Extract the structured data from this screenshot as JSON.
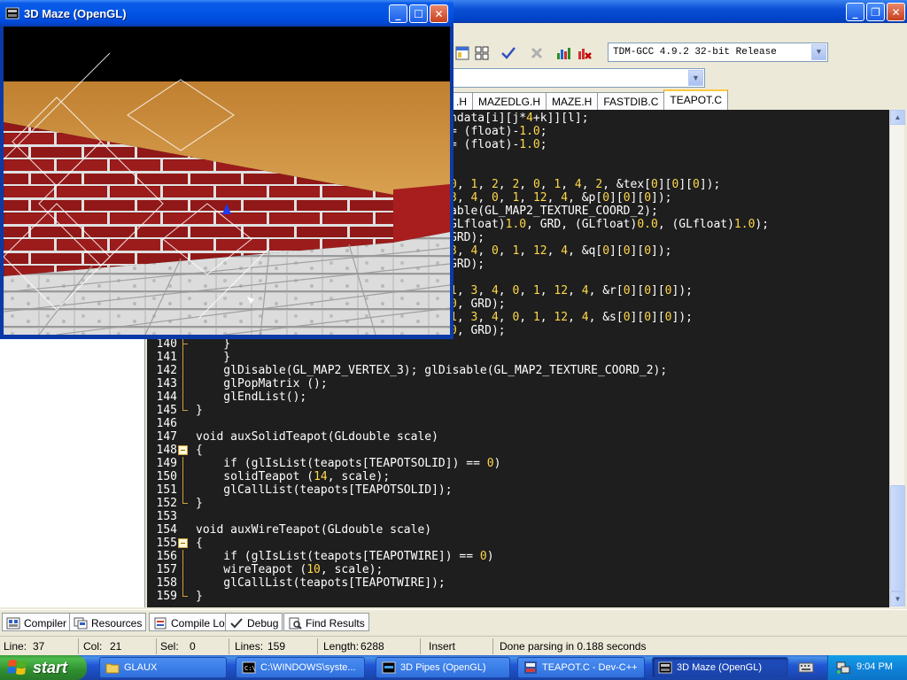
{
  "ide": {
    "compiler": "TDM-GCC 4.9.2 32-bit Release",
    "file_tabs": [
      {
        "label": ".H",
        "active": false
      },
      {
        "label": "MAZEDLG.H",
        "active": false
      },
      {
        "label": "MAZE.H",
        "active": false
      },
      {
        "label": "FASTDIB.C",
        "active": false
      },
      {
        "label": "TEAPOT.C",
        "active": true
      }
    ],
    "code_lines": [
      {
        "ln": "",
        "text": "ndata[i][j*4+k]][l];",
        "fold": "",
        "guide": ""
      },
      {
        "ln": "",
        "text": "= (float)-1.0;",
        "fold": "",
        "guide": ""
      },
      {
        "ln": "",
        "text": "= (float)-1.0;",
        "fold": "",
        "guide": ""
      },
      {
        "ln": "",
        "text": "",
        "fold": "",
        "guide": ""
      },
      {
        "ln": "",
        "text": "",
        "fold": "",
        "guide": ""
      },
      {
        "ln": "",
        "text": "0, 1, 2, 2, 0, 1, 4, 2, &tex[0][0][0]);",
        "fold": "",
        "guide": ""
      },
      {
        "ln": "",
        "text": "3, 4, 0, 1, 12, 4, &p[0][0][0]);",
        "fold": "",
        "guide": ""
      },
      {
        "ln": "",
        "text": "able(GL_MAP2_TEXTURE_COORD_2);",
        "fold": "",
        "guide": ""
      },
      {
        "ln": "",
        "text": "GLfloat)1.0, GRD, (GLfloat)0.0, (GLfloat)1.0);",
        "fold": "",
        "guide": ""
      },
      {
        "ln": "",
        "text": "GRD);",
        "fold": "",
        "guide": ""
      },
      {
        "ln": "",
        "text": "3, 4, 0, 1, 12, 4, &q[0][0][0]);",
        "fold": "",
        "guide": ""
      },
      {
        "ln": "",
        "text": "GRD);",
        "fold": "",
        "guide": ""
      },
      {
        "ln": "",
        "text": "",
        "fold": "",
        "guide": ""
      },
      {
        "ln": "",
        "text": "1, 3, 4, 0, 1, 12, 4, &r[0][0][0]);",
        "fold": "",
        "guide": ""
      },
      {
        "ln": "",
        "text": "0, GRD);",
        "fold": "",
        "guide": ""
      },
      {
        "ln": "",
        "text": "1, 3, 4, 0, 1, 12, 4, &s[0][0][0]);",
        "fold": "",
        "guide": ""
      },
      {
        "ln": "",
        "text": "0, GRD);",
        "fold": "",
        "guide": ""
      },
      {
        "ln": "140",
        "text": "    }",
        "fold": "",
        "guide": "end"
      },
      {
        "ln": "141",
        "text": "    }",
        "fold": "",
        "guide": "line"
      },
      {
        "ln": "142",
        "text": "    glDisable(GL_MAP2_VERTEX_3); glDisable(GL_MAP2_TEXTURE_COORD_2);",
        "fold": "",
        "guide": "line"
      },
      {
        "ln": "143",
        "text": "    glPopMatrix ();",
        "fold": "",
        "guide": "line"
      },
      {
        "ln": "144",
        "text": "    glEndList();",
        "fold": "",
        "guide": "line"
      },
      {
        "ln": "145",
        "text": "}",
        "fold": "",
        "guide": "endtop"
      },
      {
        "ln": "146",
        "text": "",
        "fold": "",
        "guide": ""
      },
      {
        "ln": "147",
        "text": "void auxSolidTeapot(GLdouble scale)",
        "fold": "",
        "guide": ""
      },
      {
        "ln": "148",
        "text": "{",
        "fold": "box",
        "guide": ""
      },
      {
        "ln": "149",
        "text": "    if (glIsList(teapots[TEAPOTSOLID]) == 0)",
        "fold": "",
        "guide": "line"
      },
      {
        "ln": "150",
        "text": "    solidTeapot (14, scale);",
        "fold": "",
        "guide": "line"
      },
      {
        "ln": "151",
        "text": "    glCallList(teapots[TEAPOTSOLID]);",
        "fold": "",
        "guide": "line"
      },
      {
        "ln": "152",
        "text": "}",
        "fold": "",
        "guide": "endtop"
      },
      {
        "ln": "153",
        "text": "",
        "fold": "",
        "guide": ""
      },
      {
        "ln": "154",
        "text": "void auxWireTeapot(GLdouble scale)",
        "fold": "",
        "guide": ""
      },
      {
        "ln": "155",
        "text": "{",
        "fold": "box",
        "guide": ""
      },
      {
        "ln": "156",
        "text": "    if (glIsList(teapots[TEAPOTWIRE]) == 0)",
        "fold": "",
        "guide": "line"
      },
      {
        "ln": "157",
        "text": "    wireTeapot (10, scale);",
        "fold": "",
        "guide": "line"
      },
      {
        "ln": "158",
        "text": "    glCallList(teapots[TEAPOTWIRE]);",
        "fold": "",
        "guide": "line"
      },
      {
        "ln": "159",
        "text": "}",
        "fold": "",
        "guide": "endtop"
      }
    ],
    "bottom_tabs": [
      "Compiler",
      "Resources",
      "Compile Log",
      "Debug",
      "Find Results"
    ],
    "status": {
      "line_label": "Line:",
      "line_value": "37",
      "col_label": "Col:",
      "col_value": "21",
      "sel_label": "Sel:",
      "sel_value": "0",
      "lines_label": "Lines:",
      "lines_value": "159",
      "length_label": "Length:",
      "length_value": "6288",
      "mode": "Insert",
      "message": "Done parsing in 0.188 seconds"
    }
  },
  "maze_window": {
    "title": "3D Maze (OpenGL)"
  },
  "taskbar": {
    "start_label": "start",
    "tasks": [
      {
        "label": "GLAUX",
        "active": false
      },
      {
        "label": "C:\\WINDOWS\\syste...",
        "active": false
      },
      {
        "label": "3D Pipes (OpenGL)",
        "active": false
      },
      {
        "label": "TEAPOT.C - Dev-C++",
        "active": false
      },
      {
        "label": "3D Maze (OpenGL)",
        "active": true
      }
    ],
    "clock": "9:04 PM"
  },
  "colors": {
    "xp_blue": "#0055e5",
    "start_green": "#3c9a3c",
    "editor_bg": "#1e1e1e",
    "number_yellow": "#ffd84a",
    "brick_red": "#8a1414",
    "ceiling_orange": "#c8882c"
  }
}
